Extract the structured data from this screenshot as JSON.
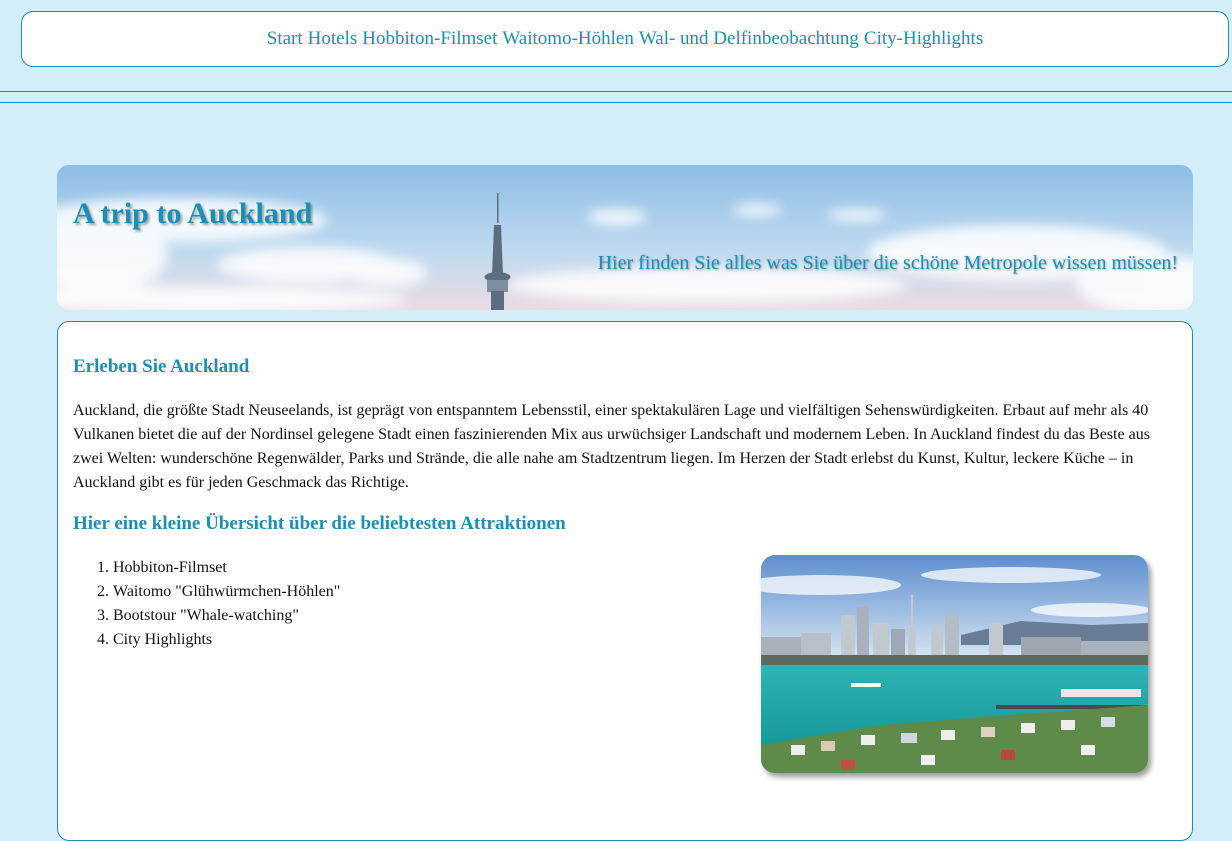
{
  "nav": {
    "items": [
      "Start",
      "Hotels",
      "Hobbiton-Filmset",
      "Waitomo-Höhlen",
      "Wal- und Delfinbeobachtung",
      "City-Highlights"
    ]
  },
  "banner": {
    "title": "A trip to Auckland",
    "subtitle": "Hier finden Sie alles was Sie über die schöne Metropole wissen müssen!"
  },
  "main": {
    "heading": "Erleben Sie Auckland",
    "intro": "Auckland, die größte Stadt Neuseelands, ist geprägt von entspanntem Lebensstil, einer spektakulären Lage und vielfältigen Sehenswürdigkeiten. Erbaut auf mehr als 40 Vulkanen bietet die auf der Nordinsel gelegene Stadt einen faszinierenden Mix aus urwüchsiger Landschaft und modernem Leben. In Auckland findest du das Beste aus zwei Welten: wunderschöne Regenwälder, Parks und Strände, die alle nahe am Stadtzentrum liegen. Im Herzen der Stadt erlebst du Kunst, Kultur, leckere Küche – in Auckland gibt es für jeden Geschmack das Richtige.",
    "subheading": "Hier eine kleine Übersicht über die beliebtesten Attraktionen",
    "attractions": [
      "Hobbiton-Filmset",
      "Waitomo \"Glühwürmchen-Höhlen\"",
      "Bootstour \"Whale-watching\"",
      "City Highlights"
    ]
  },
  "colors": {
    "accent": "#1a8fb8",
    "page_background": "#d4eef9",
    "text": "#111111"
  }
}
